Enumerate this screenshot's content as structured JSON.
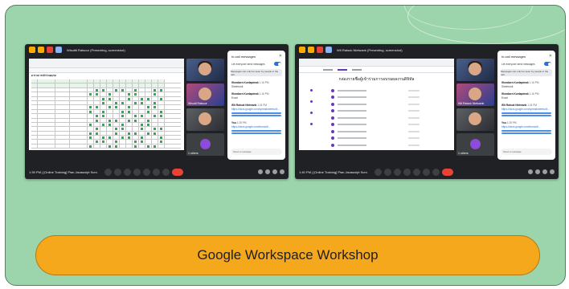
{
  "workshop": {
    "title": "Google Workspace Workshop",
    "colors": {
      "card_bg": "#9cd4ac",
      "button_bg": "#f6a81c",
      "button_border": "#b5790f"
    }
  },
  "screenshots": [
    {
      "presenting_label": "Wisutiti Ratsour (Presenting, screenshot)",
      "bottom_time": "1:39 PM | [Online Training] Plan Javascript Scre...",
      "participants": [
        "",
        "Wisutti Ratsour",
        "",
        "1 others"
      ],
      "chat": {
        "title": "In-call messages",
        "toggle_label": "Let everyone send messages",
        "note": "Messages can only be seen by people in the call",
        "messages": [
          {
            "author": "Worakarn Kuntapimak",
            "time": "1:16 PM",
            "text": "Sheet/unit"
          },
          {
            "author": "Worakarn Kuntapimak",
            "time": "1:16 PM",
            "text": "Excel"
          },
          {
            "author": "Wit Ratsuk Nietwank",
            "time": "1:24 PM",
            "text": "https://docs.google.com/spreadsheets/d/..."
          },
          {
            "author": "You",
            "time": "1:28 PM",
            "text": "https://docs.google.com/forms/d/..."
          }
        ],
        "send_placeholder": "Send a message"
      },
      "sheet_title": "ตารางการเข้าร่วมอบรม"
    },
    {
      "presenting_label": "Wit Ratsuk Nietwank (Presenting, screenshot)",
      "bottom_time": "1:40 PM | [Online Training] Plan Javascript Scre...",
      "participants": [
        "",
        "Wit Ratsuk Nietwank",
        "",
        "1 others"
      ],
      "chat": {
        "title": "In-call messages",
        "toggle_label": "Let everyone send messages",
        "note": "Messages can only be seen by people in the call",
        "messages": [
          {
            "author": "Worakarn Kuntapimak",
            "time": "1:16 PM",
            "text": "Sheet/unit"
          },
          {
            "author": "Worakarn Kuntapimak",
            "time": "1:16 PM",
            "text": "Excel"
          },
          {
            "author": "Wit Ratsuk Nietwank",
            "time": "1:24 PM",
            "text": "https://docs.google.com/spreadsheets/d/..."
          },
          {
            "author": "You",
            "time": "1:28 PM",
            "text": "https://docs.google.com/forms/d/..."
          }
        ],
        "send_placeholder": "Send a message"
      },
      "form_title": "กล่องรายชื่อผู้เข้าร่วมการอบรมผลงานดิจิทัล"
    }
  ]
}
